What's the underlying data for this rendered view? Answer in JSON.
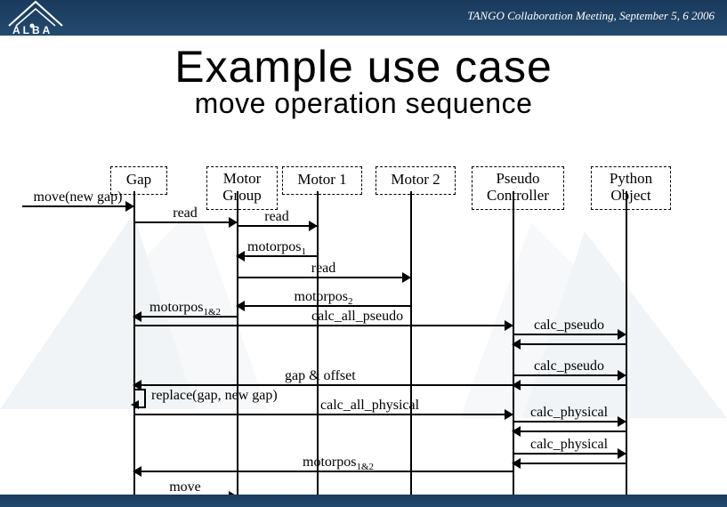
{
  "header": {
    "meeting": "TANGO Collaboration Meeting, September 5, 6 2006"
  },
  "titles": {
    "main": "Example use case",
    "sub": "move operation sequence"
  },
  "lifelines": {
    "gap": "Gap",
    "group": "Motor\nGroup",
    "motor1": "Motor 1",
    "motor2": "Motor 2",
    "pseudo": "Pseudo\nController",
    "python": "Python\nObject"
  },
  "messages": {
    "move_new_gap": "move(new gap)",
    "read1": "read",
    "read2": "read",
    "motorpos1": "motorpos",
    "motorpos1_sub": "1",
    "read3": "read",
    "motorpos2": "motorpos",
    "motorpos2_sub": "2",
    "motorpos12a": "motorpos",
    "motorpos12a_sub": "1&2",
    "calc_all_pseudo": "calc_all_pseudo",
    "calc_pseudo1": "calc_pseudo",
    "calc_pseudo2": "calc_pseudo",
    "gap_offset": "gap & offset",
    "replace": "replace(gap, new gap)",
    "calc_all_physical": "calc_all_physical",
    "calc_physical1": "calc_physical",
    "calc_physical2": "calc_physical",
    "motorpos12b": "motorpos",
    "motorpos12b_sub": "1&2",
    "move": "move"
  }
}
